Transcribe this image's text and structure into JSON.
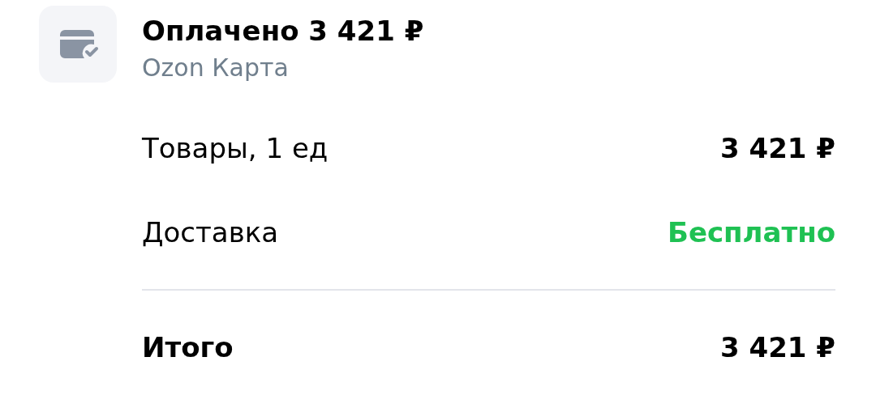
{
  "payment": {
    "title": "Оплачено 3 421 ₽",
    "method": "Ozon Карта"
  },
  "rows": [
    {
      "kind": "regular",
      "label": "Товары, 1 ед",
      "value": "3 421 ₽"
    },
    {
      "kind": "free",
      "label": "Доставка",
      "value": "Бесплатно"
    },
    {
      "kind": "total",
      "label": "Итого",
      "value": "3 421 ₽"
    }
  ]
}
